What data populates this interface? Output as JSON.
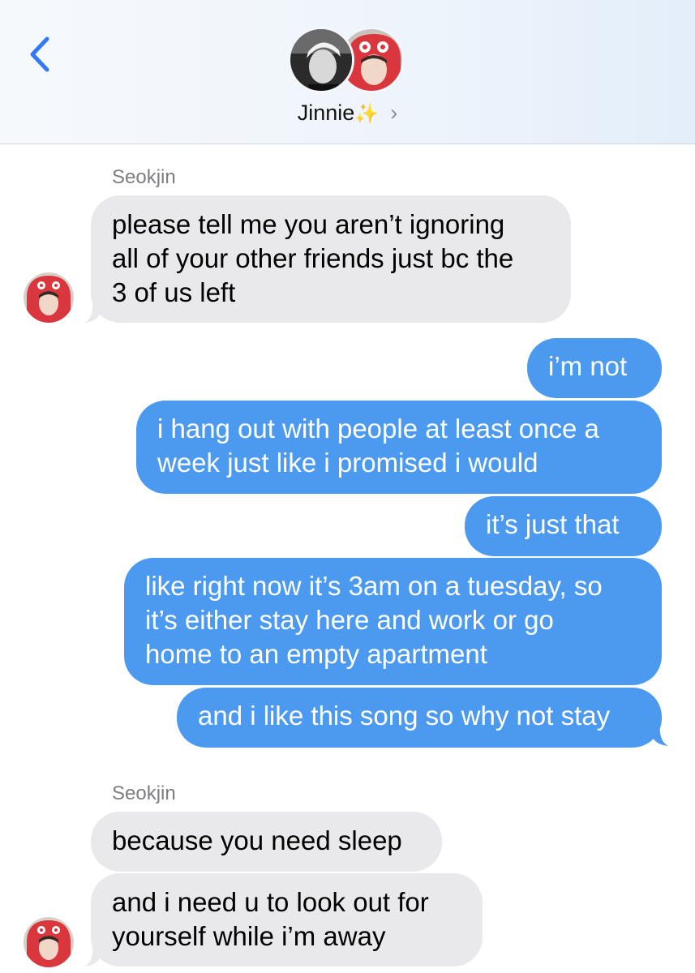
{
  "header": {
    "contact_name": "Jinnie",
    "sparkle": "✨",
    "chevron": "›",
    "back_icon": "chevron-left-icon"
  },
  "colors": {
    "incoming_bubble": "#e9e9eb",
    "outgoing_bubble": "#4c9af0",
    "back_button": "#3478f6",
    "sender_label": "#7d7d82"
  },
  "messages": [
    {
      "sender": "Seokjin"
    },
    {
      "lines": [
        "please tell me you aren’t ignoring",
        "all of your other friends just bc the",
        "3 of us left"
      ]
    },
    {
      "lines": [
        "i’m not"
      ]
    },
    {
      "lines": [
        "i hang out with people at least once a",
        "week just like i promised i would"
      ]
    },
    {
      "lines": [
        "it’s just that"
      ]
    },
    {
      "lines": [
        "like right now it’s 3am on a tuesday, so",
        "it’s either stay here and work or go",
        "home to an empty apartment"
      ]
    },
    {
      "lines": [
        "and i like this song so why not stay"
      ]
    },
    {
      "sender": "Seokjin"
    },
    {
      "lines": [
        "because you need sleep"
      ]
    },
    {
      "lines": [
        "and i need u to look out for",
        "yourself while i’m away"
      ]
    }
  ]
}
